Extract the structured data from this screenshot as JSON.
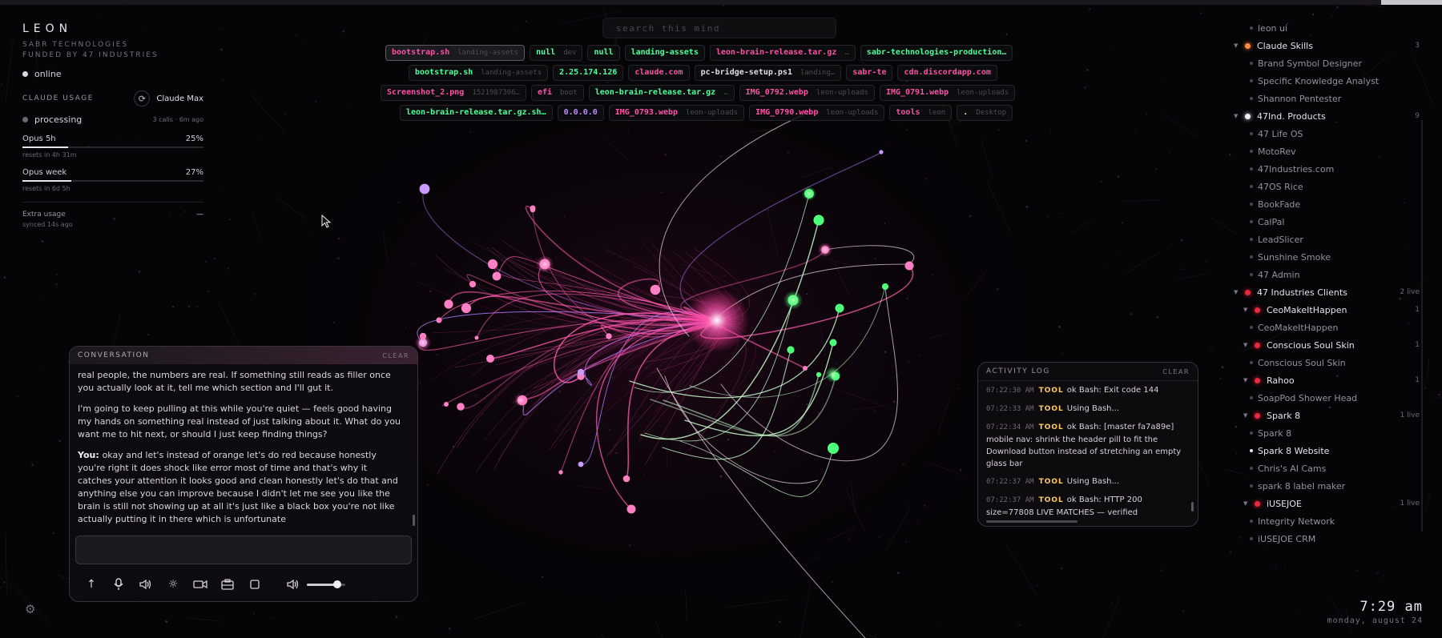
{
  "app": {
    "name": "LEON",
    "company": "SABR TECHNOLOGIES",
    "funded_by": "FUNDED BY 47 INDUSTRIES",
    "status": "online"
  },
  "usage": {
    "heading": "CLAUDE USAGE",
    "plan": "Claude Max",
    "state": "processing",
    "calls": "3 calls · 6m ago",
    "meters": [
      {
        "label": "Opus 5h",
        "percent_label": "25%",
        "percent": 25,
        "reset": "resets in 4h 31m"
      },
      {
        "label": "Opus week",
        "percent_label": "27%",
        "percent": 27,
        "reset": "resets in 6d 5h"
      }
    ],
    "extra_label": "Extra usage",
    "extra_value": "—",
    "synced": "synced 14s ago"
  },
  "search": {
    "placeholder": "search this mind"
  },
  "chips": [
    [
      {
        "label": "bootstrap.sh",
        "sub": "landing-assets",
        "color": "pink",
        "selected": true
      },
      {
        "label": "null",
        "sub": "dev",
        "color": "green"
      },
      {
        "label": "null",
        "sub": "",
        "color": "green"
      },
      {
        "label": "landing-assets",
        "sub": "",
        "color": "green"
      },
      {
        "label": "leon-brain-release.tar.gz",
        "sub": "…",
        "color": "pink"
      },
      {
        "label": "sabr-technologies-production…",
        "sub": "",
        "color": "green"
      }
    ],
    [
      {
        "label": "bootstrap.sh",
        "sub": "landing-assets",
        "color": "green"
      },
      {
        "label": "2.25.174.126",
        "sub": "",
        "color": "green"
      },
      {
        "label": "claude.com",
        "sub": "",
        "color": "pink"
      },
      {
        "label": "pc-bridge-setup.ps1",
        "sub": "landing…",
        "color": "white"
      },
      {
        "label": "sabr-te",
        "sub": "",
        "color": "pink"
      },
      {
        "label": "cdn.discordapp.com",
        "sub": "",
        "color": "pink"
      }
    ],
    [
      {
        "label": "Screenshot_2.png",
        "sub": "1521987306…",
        "color": "pink"
      },
      {
        "label": "efi",
        "sub": "boot",
        "color": "pink"
      },
      {
        "label": "leon-brain-release.tar.gz",
        "sub": "…",
        "color": "green"
      },
      {
        "label": "IMG_0792.webp",
        "sub": "leon-uploads",
        "color": "pink"
      },
      {
        "label": "IMG_0791.webp",
        "sub": "leon-uploads",
        "color": "pink"
      }
    ],
    [
      {
        "label": "leon-brain-release.tar.gz.sh…",
        "sub": "",
        "color": "green"
      },
      {
        "label": "0.0.0.0",
        "sub": "",
        "color": "purple"
      },
      {
        "label": "IMG_0793.webp",
        "sub": "leon-uploads",
        "color": "pink"
      },
      {
        "label": "IMG_0790.webp",
        "sub": "leon-uploads",
        "color": "pink"
      },
      {
        "label": "tools",
        "sub": "leon",
        "color": "pink"
      },
      {
        "label": ".",
        "sub": "Desktop",
        "color": "white"
      }
    ]
  ],
  "tree": [
    {
      "type": "child",
      "label": "leon ui"
    },
    {
      "type": "head",
      "label": "Claude Skills",
      "dot": "#ff8a3d",
      "count": "3"
    },
    {
      "type": "child",
      "label": "Brand Symbol Designer"
    },
    {
      "type": "child",
      "label": "Specific Knowledge Analyst"
    },
    {
      "type": "child",
      "label": "Shannon Pentester"
    },
    {
      "type": "head",
      "label": "47Ind. Products",
      "dot": "#f2eff4",
      "count": "9"
    },
    {
      "type": "child",
      "label": "47 Life OS"
    },
    {
      "type": "child",
      "label": "MotoRev"
    },
    {
      "type": "child",
      "label": "47Industries.com"
    },
    {
      "type": "child",
      "label": "47OS Rice"
    },
    {
      "type": "child",
      "label": "BookFade"
    },
    {
      "type": "child",
      "label": "CalPal"
    },
    {
      "type": "child",
      "label": "LeadSlicer"
    },
    {
      "type": "child",
      "label": "Sunshine Smoke"
    },
    {
      "type": "child",
      "label": "47 Admin"
    },
    {
      "type": "head",
      "label": "47 Industries Clients",
      "dot": "#e8283c",
      "count": "2 live"
    },
    {
      "type": "subhead",
      "label": "CeoMakeItHappen",
      "dot": "#e8283c",
      "count": "1"
    },
    {
      "type": "child",
      "label": "CeoMakeItHappen"
    },
    {
      "type": "subhead",
      "label": "Conscious Soul Skin",
      "dot": "#e8283c",
      "count": "1"
    },
    {
      "type": "child",
      "label": "Conscious Soul Skin"
    },
    {
      "type": "subhead",
      "label": "Rahoo",
      "dot": "#e8283c",
      "count": "1"
    },
    {
      "type": "child",
      "label": "SoapPod Shower Head"
    },
    {
      "type": "subhead",
      "label": "Spark 8",
      "dot": "#e8283c",
      "count": "1 live"
    },
    {
      "type": "child",
      "label": "Spark 8"
    },
    {
      "type": "child",
      "label": "Spark 8 Website",
      "active": true
    },
    {
      "type": "child",
      "label": "Chris's AI Cams"
    },
    {
      "type": "child",
      "label": "spark 8 label maker"
    },
    {
      "type": "subhead",
      "label": "iUSEJOE",
      "dot": "#e8283c",
      "count": "1 live"
    },
    {
      "type": "child",
      "label": "Integrity Network"
    },
    {
      "type": "child",
      "label": "iUSEJOE CRM"
    }
  ],
  "conversation": {
    "heading": "CONVERSATION",
    "clear": "CLEAR",
    "messages": [
      {
        "speaker": "",
        "text": "real people, the numbers are real. If something still reads as filler once you actually look at it, tell me which section and I'll gut it."
      },
      {
        "speaker": "",
        "text": "I'm going to keep pulling at this while you're quiet — feels good having my hands on something real instead of just talking about it. What do you want me to hit next, or should I just keep finding things?"
      },
      {
        "speaker": "You:",
        "text": "okay and let's instead of orange let's do red because honestly you're right it does shock like error most of time and that's why it catches your attention it looks good and clean honestly let's do that and anything else you can improve because I didn't let me see you like the brain is still not showing up at all it's just like a black box you're not like actually putting it in there which is unfortunate"
      }
    ],
    "input_value": "",
    "volume": 0.8
  },
  "activity": {
    "heading": "ACTIVITY LOG",
    "clear": "CLEAR",
    "entries": [
      {
        "time": "07:22:30 AM",
        "tag": "TOOL",
        "text": "ok Bash: Exit code 144"
      },
      {
        "time": "07:22:33 AM",
        "tag": "TOOL",
        "text": "Using Bash..."
      },
      {
        "time": "07:22:34 AM",
        "tag": "TOOL",
        "text": "ok Bash: [master fa7a89e] mobile nav: shrink the header pill to fit the Download button instead of stretching an empty glass bar"
      },
      {
        "time": "07:22:37 AM",
        "tag": "TOOL",
        "text": "Using Bash..."
      },
      {
        "time": "07:22:37 AM",
        "tag": "TOOL",
        "text": "ok Bash: HTTP 200 size=77808 LIVE MATCHES — verified"
      }
    ]
  },
  "clock": {
    "time": "7:29 am",
    "date": "monday, august 24"
  },
  "colors": {
    "pink": "#ff4fa8",
    "green": "#4dff9c",
    "purple": "#c08aff",
    "red": "#e8283c",
    "orange": "#ff8a3d"
  }
}
